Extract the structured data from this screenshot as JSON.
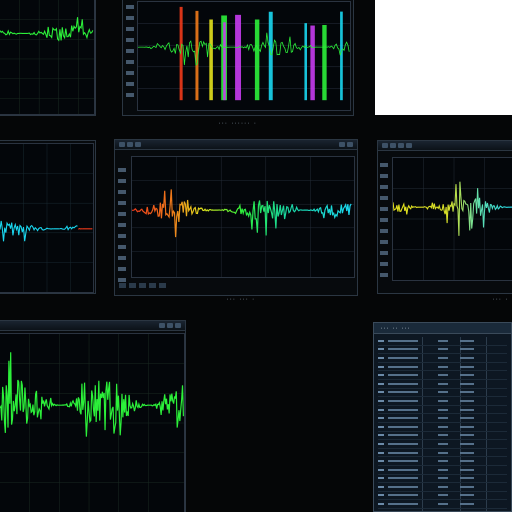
{
  "colors": {
    "green": "#2cf03a",
    "cyan": "#1ad7f0",
    "yellow": "#e4e21c",
    "red": "#f03a1a",
    "magenta": "#c83cf0",
    "background": "#050607"
  },
  "panels": {
    "top_left": {
      "waveform_color": "green"
    },
    "top_center": {
      "footnote": "··· ······ ·"
    },
    "mid_left": {
      "waveform_color": "cyan"
    },
    "mid_center": {
      "footnote": "··· ··· ·"
    },
    "mid_right": {
      "footnote": "··· ·"
    },
    "bottom_left": {
      "waveform_color": "green"
    },
    "bottom_right": {
      "header": "··· ·· ···"
    }
  }
}
